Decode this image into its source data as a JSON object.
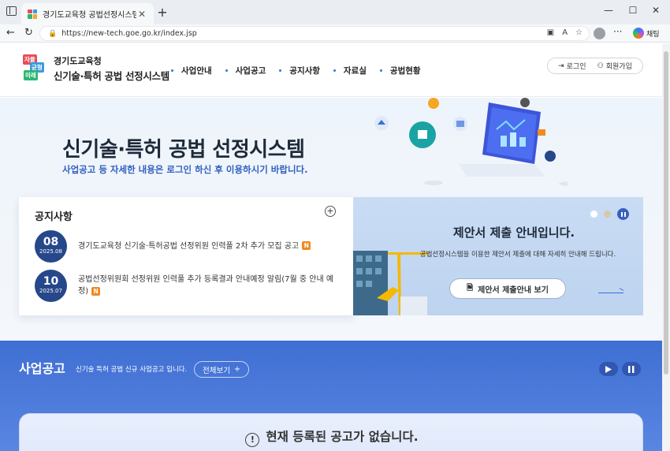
{
  "browser": {
    "tab_title": "경기도교육청 공법선정시스템",
    "tab_close": "✕",
    "new_tab": "+",
    "url": "https://new-tech.goe.go.kr/index.jsp",
    "copilot_label": "채팅",
    "win_min": "—",
    "win_max": "☐",
    "win_close": "✕",
    "back": "←",
    "reload": "↻",
    "more": "···"
  },
  "header": {
    "logo_badges": [
      "자율",
      "균형",
      "미래"
    ],
    "org": "경기도교육청",
    "system_name": "신기술·특허 공법 선정시스템",
    "nav": [
      "사업안내",
      "사업공고",
      "공지사항",
      "자료실",
      "공법현황"
    ],
    "login": "로그인",
    "signup": "회원가입"
  },
  "hero": {
    "title": "신기술·특허 공법 선정시스템",
    "subtitle": "사업공고 등 자세한 내용은 로그인 하신 후 이용하시기 바랍니다."
  },
  "notice": {
    "title": "공지사항",
    "plus": "+",
    "items": [
      {
        "day": "08",
        "ym": "2025.08",
        "text": "경기도교육청 신기술·특허공법 선정위원 인력풀 2차 추가 모집 공고",
        "badge": "N"
      },
      {
        "day": "10",
        "ym": "2025.07",
        "text": "공법선정위원회 선정위원 인력풀 추가 등록결과 안내예정 알림(7월 중 안내 예정)",
        "badge": "N"
      }
    ]
  },
  "banner": {
    "title": "제안서 제출 안내입니다.",
    "description": "공법선정시스템을 이용한 제안서 제출에 대해 자세히 안내해 드립니다.",
    "button": "제안서 제출안내 보기"
  },
  "business": {
    "title": "사업공고",
    "description": "신기술 특허 공법 신규 사업공고 입니다.",
    "view_all": "전체보기",
    "view_all_plus": "+",
    "empty_message": "현재 등록된 공고가 없습니다.",
    "warn_glyph": "!"
  },
  "colors": {
    "accent": "#3a6fd8",
    "date_badge": "#26478a",
    "new_badge": "#f08a24",
    "section_blue": "#3f6fd3"
  }
}
